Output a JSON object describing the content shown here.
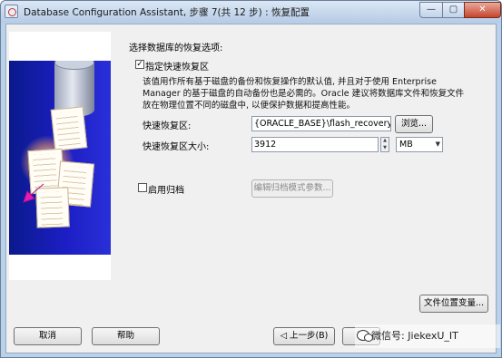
{
  "window": {
    "title": "Database Configuration Assistant, 步骤 7(共 12 步) : 恢复配置",
    "minimize": "—",
    "maximize": "▢",
    "close": "✕"
  },
  "recovery": {
    "section_title": "选择数据库的恢复选项:",
    "fast_recovery_checked": "✓",
    "fast_recovery_label": "指定快速恢复区",
    "description": "该值用作所有基于磁盘的备份和恢复操作的默认值, 并且对于使用 Enterprise Manager 的基于磁盘的自动备份也是必需的。Oracle 建议将数据库文件和恢复文件放在物理位置不同的磁盘中, 以便保护数据和提高性能。",
    "area_label": "快速恢复区:",
    "area_value": "{ORACLE_BASE}\\flash_recovery_area",
    "browse_label": "浏览...",
    "size_label": "快速恢复区大小:",
    "size_value": "3912",
    "size_unit": "MB",
    "archive_checked": "",
    "archive_label": "启用归档",
    "edit_archive_label": "编辑归档模式参数...",
    "file_locations_label": "文件位置变量..."
  },
  "footer": {
    "cancel": "取消",
    "help": "帮助",
    "back": "上一步(B)",
    "next": "下",
    "watermark": "微信号: JiekexU_IT"
  },
  "colors": {
    "banner_blue": "#1c1ec4",
    "titlebar": "#b9d1ea",
    "close_red": "#c7452f"
  },
  "icons": {
    "app": "oracle-dbca-icon",
    "back": "back-arrow-icon",
    "next": "next-arrow-icon",
    "dropdown": "chevron-down-icon",
    "watermark": "wechat-icon"
  }
}
